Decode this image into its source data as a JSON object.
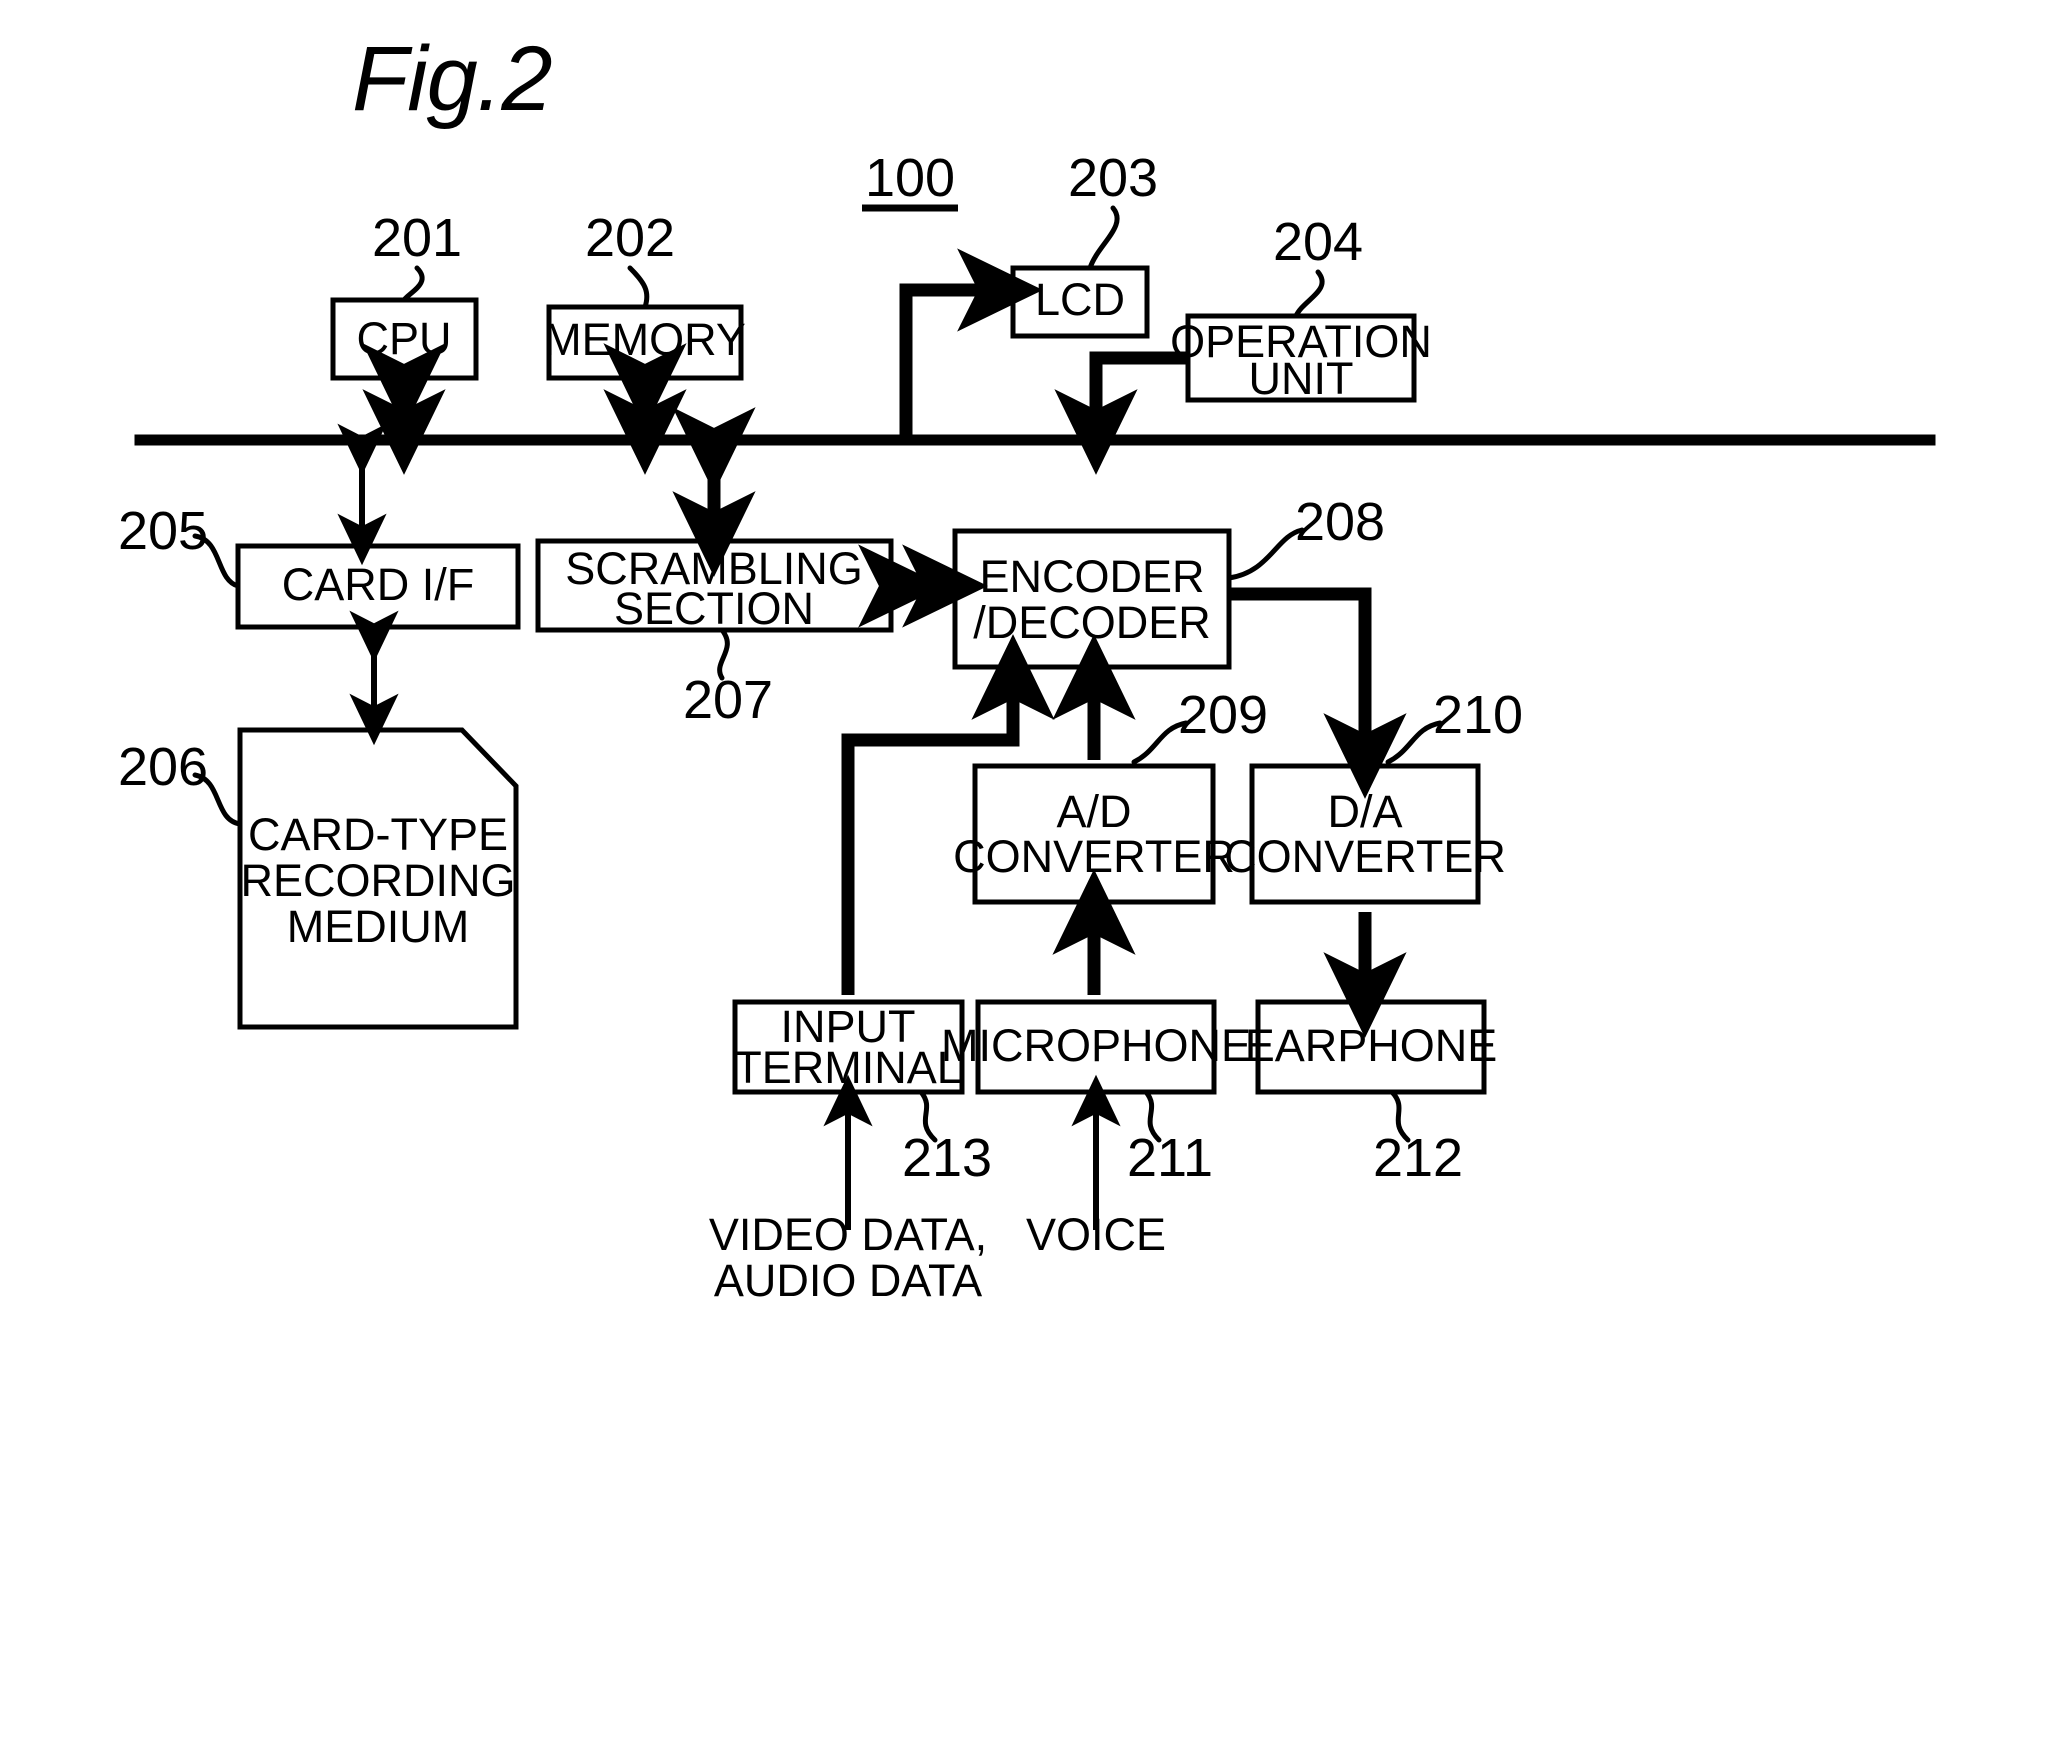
{
  "figure": {
    "title": "Fig.2",
    "system_ref": "100"
  },
  "blocks": [
    {
      "id": "cpu",
      "label": "CPU",
      "ref": "201"
    },
    {
      "id": "memory",
      "label": "MEMORY",
      "ref": "202"
    },
    {
      "id": "lcd",
      "label": "LCD",
      "ref": "203"
    },
    {
      "id": "operation",
      "label_line1": "OPERATION",
      "label_line2": "UNIT",
      "ref": "204"
    },
    {
      "id": "card_if",
      "label": "CARD  I/F",
      "ref": "205"
    },
    {
      "id": "card_media",
      "label_line1": "CARD-TYPE",
      "label_line2": "RECORDING",
      "label_line3": "MEDIUM",
      "ref": "206"
    },
    {
      "id": "scrambling",
      "label_line1": "SCRAMBLING",
      "label_line2": "SECTION",
      "ref": "207"
    },
    {
      "id": "codec",
      "label_line1": "ENCODER",
      "label_line2": "/DECODER",
      "ref": "208"
    },
    {
      "id": "adc",
      "label_line1": "A/D",
      "label_line2": "CONVERTER",
      "ref": "209"
    },
    {
      "id": "dac",
      "label_line1": "D/A",
      "label_line2": "CONVERTER",
      "ref": "210"
    },
    {
      "id": "microphone",
      "label": "MICROPHONE",
      "ref": "211"
    },
    {
      "id": "earphone",
      "label": "EARPHONE",
      "ref": "212"
    },
    {
      "id": "input_term",
      "label_line1": "INPUT",
      "label_line2": "TERMINAL",
      "ref": "213"
    }
  ],
  "external_labels": {
    "video_audio_line1": "VIDEO  DATA,",
    "video_audio_line2": "AUDIO  DATA",
    "voice": "VOICE"
  },
  "colors": {
    "ink": "#000000",
    "paper": "#ffffff"
  }
}
